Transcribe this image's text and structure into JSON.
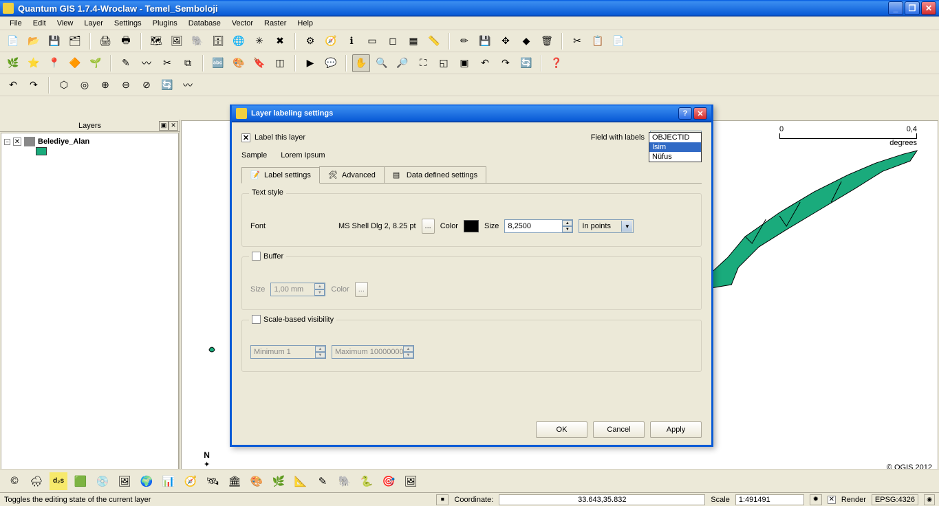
{
  "window": {
    "title": "Quantum GIS 1.7.4-Wroclaw - Temel_Semboloji"
  },
  "menu": {
    "items": [
      "File",
      "Edit",
      "View",
      "Layer",
      "Settings",
      "Plugins",
      "Database",
      "Vector",
      "Raster",
      "Help"
    ]
  },
  "layers_panel": {
    "title": "Layers",
    "layer_name": "Belediye_Alan"
  },
  "map": {
    "scalebar": {
      "left": "0",
      "right": "0,4",
      "unit": "degrees"
    },
    "north_label": "N",
    "copyright": "© QGIS 2012"
  },
  "dialog": {
    "title": "Layer labeling settings",
    "label_this_layer": "Label this layer",
    "field_with_labels": "Field with labels",
    "field_options": [
      "OBJECTID",
      "Isim",
      "Nüfus"
    ],
    "field_selected": "Isim",
    "sample_label": "Sample",
    "sample_text": "Lorem Ipsum",
    "tabs": {
      "label_settings": "Label settings",
      "advanced": "Advanced",
      "data_defined": "Data defined settings"
    },
    "text_style": {
      "legend": "Text style",
      "font_label": "Font",
      "font_value": "MS Shell Dlg 2, 8.25 pt",
      "font_btn": "...",
      "color_label": "Color",
      "size_label": "Size",
      "size_value": "8,2500",
      "unit_value": "In points"
    },
    "buffer": {
      "legend": "Buffer",
      "size_label": "Size",
      "size_value": "1,00 mm",
      "color_label": "Color",
      "color_btn": "..."
    },
    "scale_vis": {
      "legend": "Scale-based visibility",
      "min_value": "Minimum 1",
      "max_value": "Maximum 10000000"
    },
    "buttons": {
      "ok": "OK",
      "cancel": "Cancel",
      "apply": "Apply"
    }
  },
  "statusbar": {
    "message": "Toggles the editing state of the current layer",
    "coord_label": "Coordinate:",
    "coord_value": "33.643,35.832",
    "scale_label": "Scale",
    "scale_value": "1:491491",
    "render_label": "Render",
    "epsg": "EPSG:4326"
  }
}
